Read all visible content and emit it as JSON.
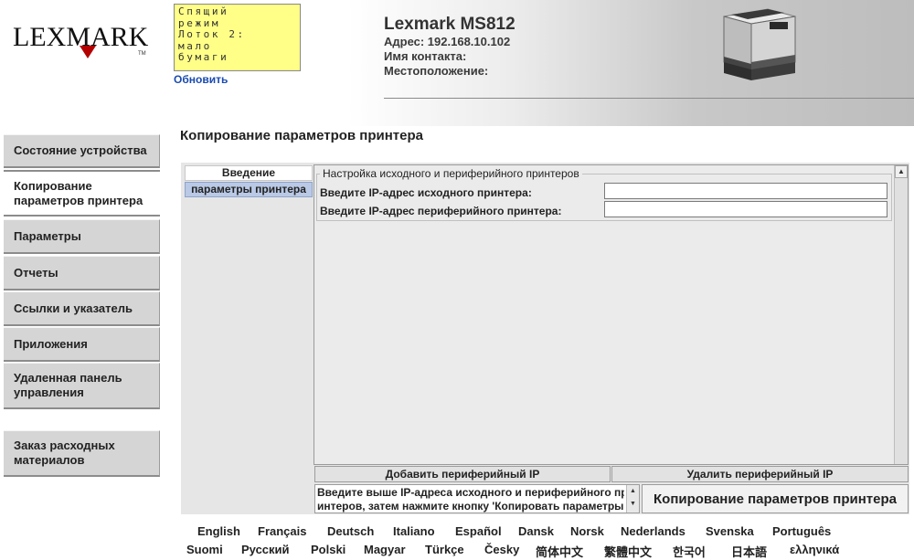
{
  "header": {
    "logo_text": "LEXMARK",
    "logo_tm": "TM",
    "status_lines": [
      "Спящий",
      "режим",
      "Лоток 2:",
      "мало",
      "бумаги"
    ],
    "refresh_label": "Обновить",
    "model": "Lexmark MS812",
    "address": "Адрес: 192.168.10.102",
    "contact": "Имя контакта:",
    "location": "Местоположение:"
  },
  "sidebar": {
    "items": [
      {
        "label": "Состояние устройства"
      },
      {
        "label": "Копирование параметров принтера",
        "active": true
      },
      {
        "label": "Параметры"
      },
      {
        "label": "Отчеты"
      },
      {
        "label": "Ссылки и указатель"
      },
      {
        "label": "Приложения"
      },
      {
        "label": "Удаленная панель управления"
      },
      {
        "label": "Заказ расходных материалов"
      }
    ]
  },
  "main": {
    "title": "Копирование параметров принтера",
    "tabs": [
      {
        "label": "Введение"
      },
      {
        "label": "параметры принтера",
        "selected": true
      }
    ],
    "group_title": "Настройка исходного и периферийного принтеров",
    "source_label": "Введите IP-адрес исходного принтера:",
    "source_value": "",
    "peripheral_label": "Введите IP-адрес периферийного принтера:",
    "peripheral_value": "",
    "add_button": "Добавить периферийный IP",
    "remove_button": "Удалить периферийный IP",
    "message_lines": [
      "Введите выше IP-адреса исходного и периферийного пр",
      "интеров, затем нажмите кнопку 'Копировать параметры пр"
    ],
    "copy_button": "Копирование параметров принтера"
  },
  "languages": {
    "row1": [
      "English",
      "Français",
      "Deutsch",
      "Italiano",
      "Español",
      "Dansk",
      "Norsk",
      "Nederlands",
      "Svenska",
      "Português"
    ],
    "row2": [
      "Suomi",
      "Русский",
      "Polski",
      "Magyar",
      "Türkçe",
      "Česky",
      "简体中文",
      "繁體中文",
      "한국어",
      "日本語",
      "ελληνικά"
    ]
  },
  "colors": {
    "status_panel_bg": "#ffff88",
    "link_blue": "#1a4ab0",
    "logo_red": "#b30000",
    "selected_tab": "#b9c9e6"
  }
}
